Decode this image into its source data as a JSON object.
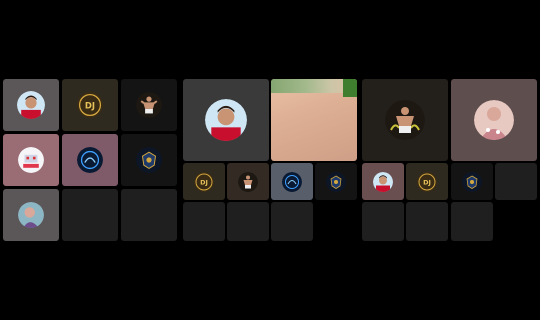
{
  "colors": {
    "background": "#000000",
    "tile_empty": "#1f1f1f",
    "gold": "#d4a740",
    "blue_logo": "#3fa0ff",
    "red_shirt": "#c8102e"
  },
  "panels": [
    {
      "name": "left-panel",
      "tiles": [
        {
          "avatar": "ronaldo-avatar-icon"
        },
        {
          "avatar": "dj-gold-logo-icon"
        },
        {
          "avatar": "flexing-man-avatar-icon"
        },
        {
          "avatar": "robot-logo-icon"
        },
        {
          "avatar": "blue-neon-logo-icon"
        },
        {
          "avatar": "gold-crest-logo-icon"
        },
        {
          "avatar": "portrait-avatar-icon"
        },
        {
          "avatar": ""
        },
        {
          "avatar": ""
        }
      ]
    },
    {
      "name": "center-panel",
      "tiles": [
        {
          "avatar": "ronaldo-avatar-icon"
        },
        {
          "avatar": "photo-thumbnail"
        },
        {
          "avatar": "dj-gold-logo-icon"
        },
        {
          "avatar": "flexing-man-avatar-icon"
        },
        {
          "avatar": "blue-neon-logo-icon"
        },
        {
          "avatar": "gold-crest-logo-icon"
        }
      ]
    },
    {
      "name": "right-panel",
      "tiles": [
        {
          "avatar": "flexing-man-avatar-icon"
        },
        {
          "avatar": "portrait-avatar-icon"
        },
        {
          "avatar": "ronaldo-avatar-icon"
        },
        {
          "avatar": "dj-gold-logo-icon"
        },
        {
          "avatar": "gold-crest-logo-icon"
        },
        {
          "avatar": ""
        }
      ]
    }
  ],
  "dj_logo_text": "DJ"
}
